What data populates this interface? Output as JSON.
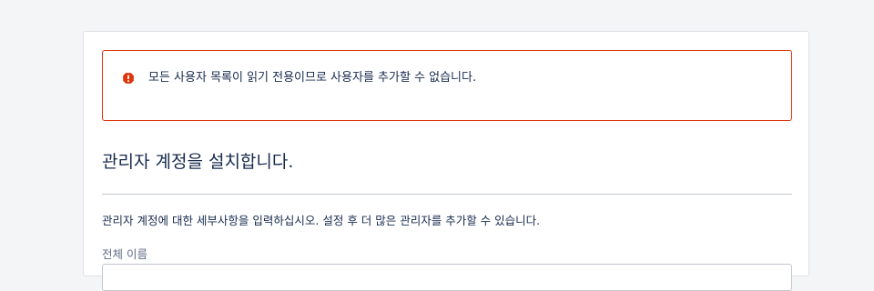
{
  "alert": {
    "icon": "error-icon",
    "color": "#de350b",
    "message": "모든 사용자 목록이 읽기 전용이므로 사용자를 추가할 수 없습니다."
  },
  "form": {
    "heading": "관리자 계정을 설치합니다.",
    "description": "관리자 계정에 대한 세부사항을 입력하십시오. 설정 후 더 많은 관리자를 추가할 수 있습니다.",
    "fields": [
      {
        "label": "전체 이름",
        "value": ""
      }
    ]
  }
}
